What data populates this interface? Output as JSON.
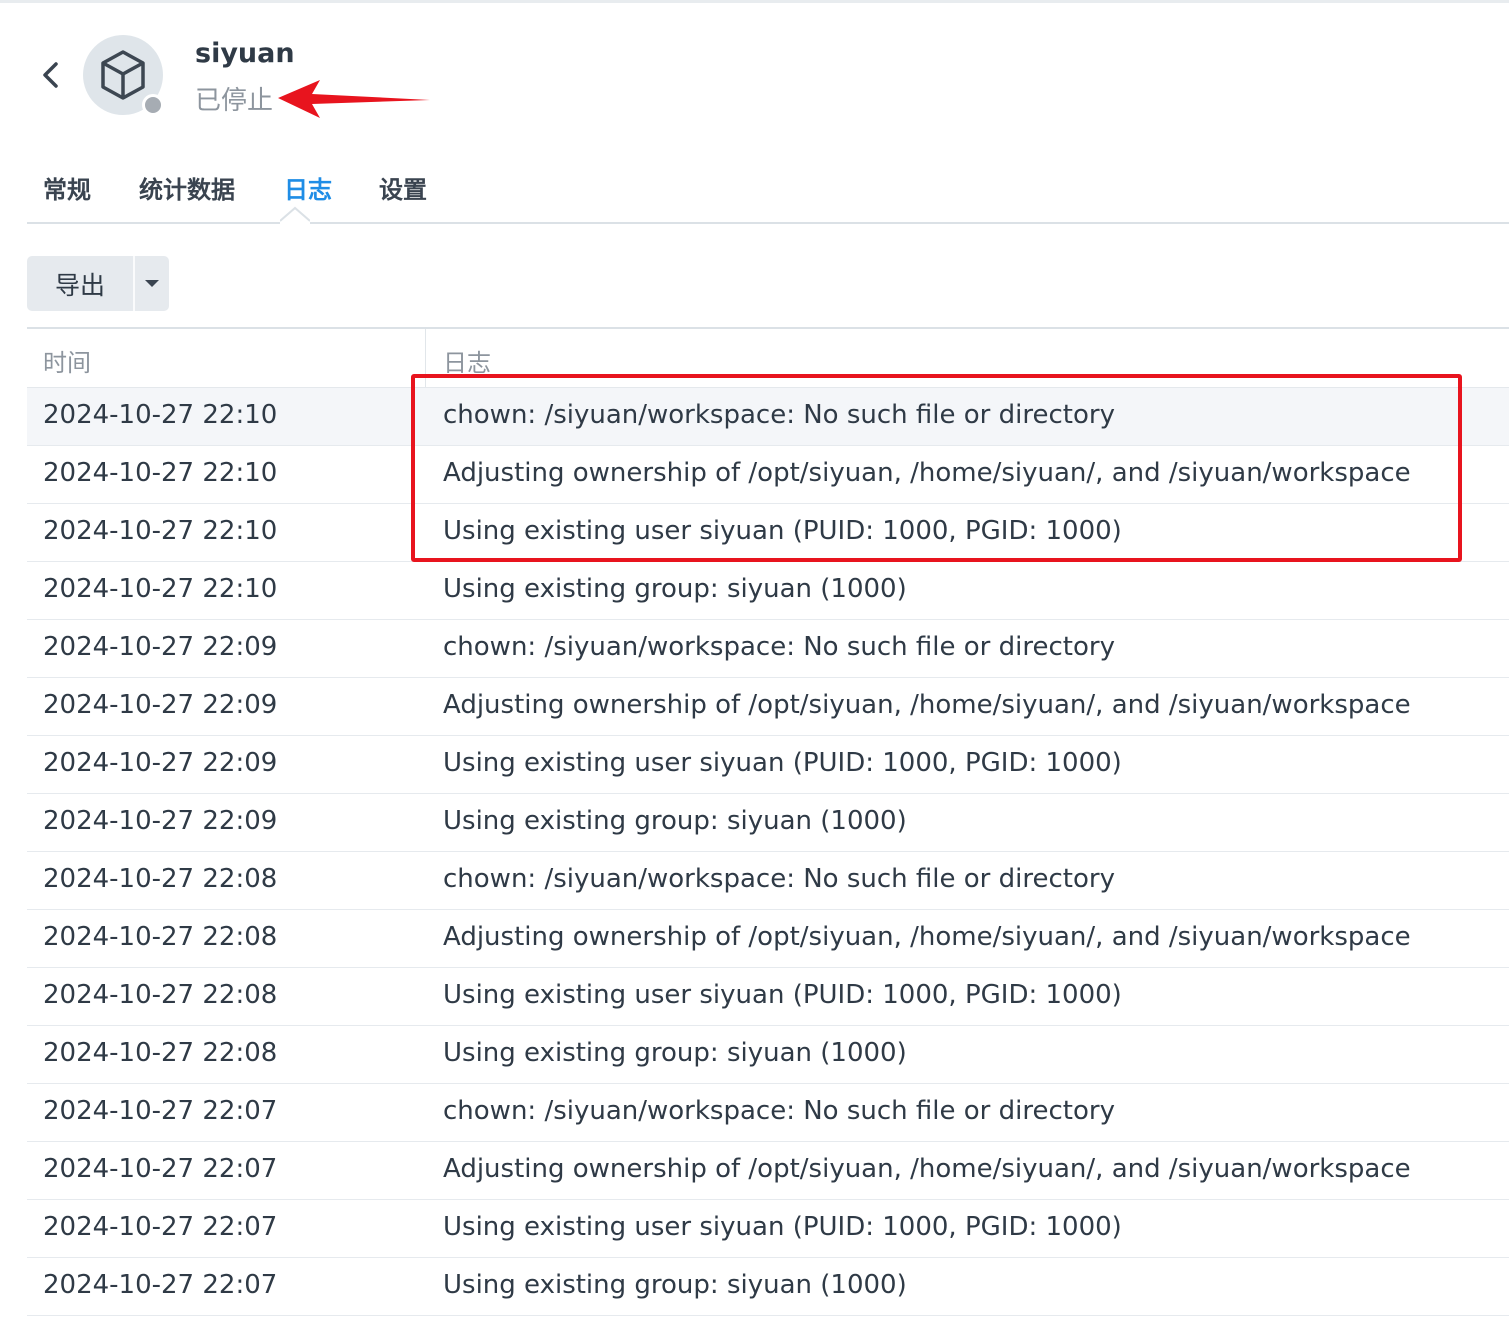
{
  "header": {
    "app_name": "siyuan",
    "app_status": "已停止",
    "back_icon": "chevron-left-icon",
    "app_icon": "cube-icon",
    "status_color": "#a6acb3"
  },
  "tabs": [
    {
      "label": "常规",
      "active": false
    },
    {
      "label": "统计数据",
      "active": false
    },
    {
      "label": "日志",
      "active": true
    },
    {
      "label": "设置",
      "active": false
    }
  ],
  "toolbar": {
    "export_label": "导出",
    "export_menu_icon": "caret-down-icon"
  },
  "table": {
    "columns": [
      "时间",
      "日志"
    ],
    "rows": [
      {
        "time": "2024-10-27 22:10",
        "log": "chown: /siyuan/workspace: No such file or directory"
      },
      {
        "time": "2024-10-27 22:10",
        "log": "Adjusting ownership of /opt/siyuan, /home/siyuan/, and /siyuan/workspace"
      },
      {
        "time": "2024-10-27 22:10",
        "log": "Using existing user siyuan (PUID: 1000, PGID: 1000)"
      },
      {
        "time": "2024-10-27 22:10",
        "log": "Using existing group: siyuan (1000)"
      },
      {
        "time": "2024-10-27 22:09",
        "log": "chown: /siyuan/workspace: No such file or directory"
      },
      {
        "time": "2024-10-27 22:09",
        "log": "Adjusting ownership of /opt/siyuan, /home/siyuan/, and /siyuan/workspace"
      },
      {
        "time": "2024-10-27 22:09",
        "log": "Using existing user siyuan (PUID: 1000, PGID: 1000)"
      },
      {
        "time": "2024-10-27 22:09",
        "log": "Using existing group: siyuan (1000)"
      },
      {
        "time": "2024-10-27 22:08",
        "log": "chown: /siyuan/workspace: No such file or directory"
      },
      {
        "time": "2024-10-27 22:08",
        "log": "Adjusting ownership of /opt/siyuan, /home/siyuan/, and /siyuan/workspace"
      },
      {
        "time": "2024-10-27 22:08",
        "log": "Using existing user siyuan (PUID: 1000, PGID: 1000)"
      },
      {
        "time": "2024-10-27 22:08",
        "log": "Using existing group: siyuan (1000)"
      },
      {
        "time": "2024-10-27 22:07",
        "log": "chown: /siyuan/workspace: No such file or directory"
      },
      {
        "time": "2024-10-27 22:07",
        "log": "Adjusting ownership of /opt/siyuan, /home/siyuan/, and /siyuan/workspace"
      },
      {
        "time": "2024-10-27 22:07",
        "log": "Using existing user siyuan (PUID: 1000, PGID: 1000)"
      },
      {
        "time": "2024-10-27 22:07",
        "log": "Using existing group: siyuan (1000)"
      }
    ]
  },
  "colors": {
    "accent": "#1f8de6",
    "annotation": "#e8141e"
  }
}
